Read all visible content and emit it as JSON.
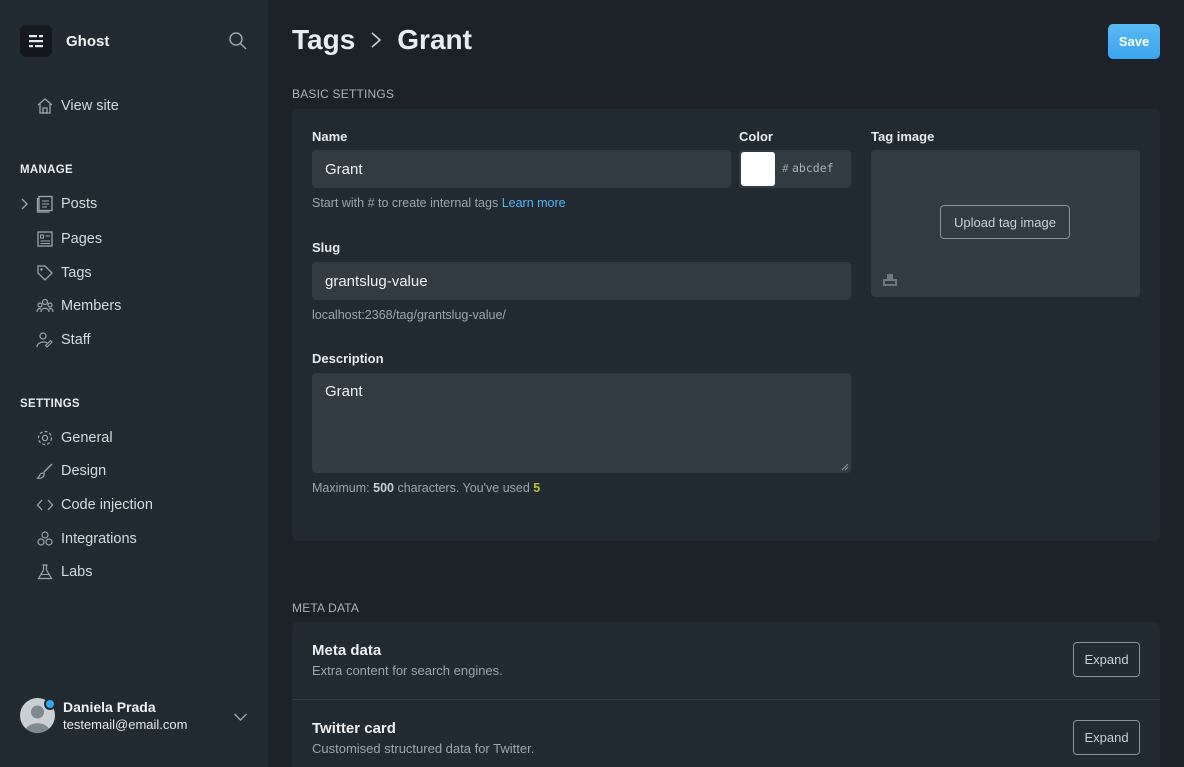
{
  "sidebar": {
    "brand": "Ghost",
    "view_site": "View site",
    "manage_label": "MANAGE",
    "manage_items": [
      "Posts",
      "Pages",
      "Tags",
      "Members",
      "Staff"
    ],
    "settings_label": "SETTINGS",
    "settings_items": [
      "General",
      "Design",
      "Code injection",
      "Integrations",
      "Labs"
    ],
    "user": {
      "name": "Daniela Prada",
      "email": "testemail@email.com"
    }
  },
  "header": {
    "crumb_parent": "Tags",
    "crumb_current": "Grant",
    "save_label": "Save"
  },
  "basic": {
    "section_label": "BASIC SETTINGS",
    "name_label": "Name",
    "name_value": "Grant",
    "name_hint": "Start with # to create internal tags ",
    "learn_more": "Learn more",
    "color_label": "Color",
    "color_hash": "#",
    "color_value": "abcdef",
    "tag_image_label": "Tag image",
    "upload_label": "Upload tag image",
    "slug_label": "Slug",
    "slug_value": "grantslug-value",
    "slug_url": "localhost:2368/tag/grantslug-value/",
    "description_label": "Description",
    "description_value": "Grant",
    "max_prefix": "Maximum: ",
    "max_value": "500",
    "max_mid": " characters. You've used ",
    "used_value": "5"
  },
  "meta": {
    "section_label": "META DATA",
    "rows": [
      {
        "title": "Meta data",
        "desc": "Extra content for search engines.",
        "button": "Expand"
      },
      {
        "title": "Twitter card",
        "desc": "Customised structured data for Twitter.",
        "button": "Expand"
      }
    ]
  },
  "colors": {
    "accent": "#3eaaf0",
    "swatch": "#ffffff",
    "used_count": "#b3c73a"
  }
}
